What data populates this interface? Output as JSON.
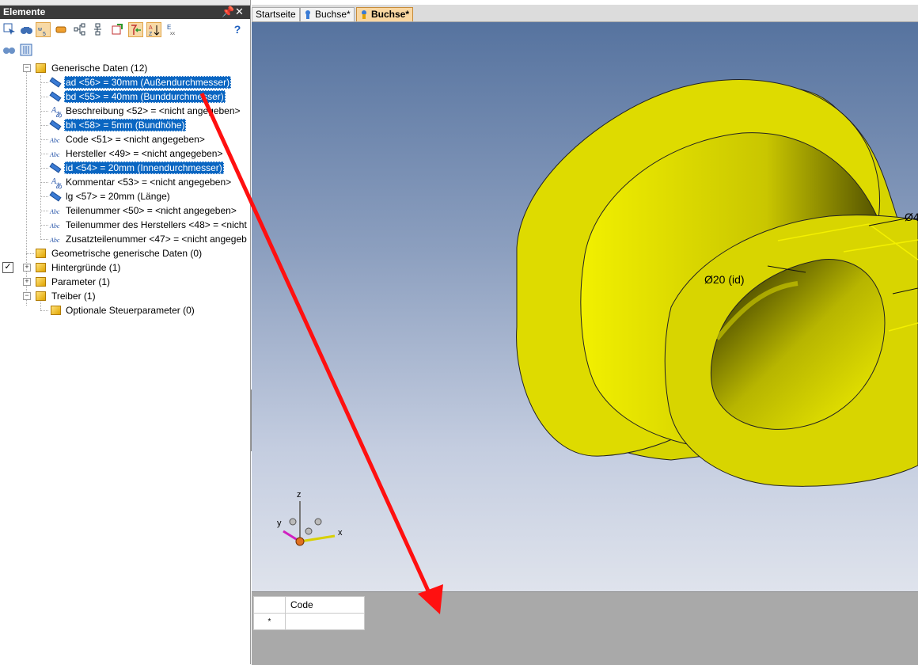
{
  "panel": {
    "title": "Elemente",
    "pin_glyph": "📌",
    "close_glyph": "✕",
    "help_glyph": "?"
  },
  "tree": {
    "root_label": "Generische Daten (12)",
    "items": [
      {
        "label": "ad <56> = 30mm (Außendurchmesser)",
        "icon": "ruler-icon",
        "selected": true
      },
      {
        "label": "bd <55> = 40mm (Bunddurchmesser)",
        "icon": "ruler-icon",
        "selected": true
      },
      {
        "label": "Beschreibung <52> = <nicht angegeben>",
        "icon": "text-icon",
        "selected": false
      },
      {
        "label": "bh <58> = 5mm (Bundhöhe)",
        "icon": "ruler-icon",
        "selected": true
      },
      {
        "label": "Code <51> = <nicht angegeben>",
        "icon": "abc-icon",
        "selected": false
      },
      {
        "label": "Hersteller <49> = <nicht angegeben>",
        "icon": "abc-icon",
        "selected": false
      },
      {
        "label": "id <54> = 20mm (Innendurchmesser)",
        "icon": "ruler-icon",
        "selected": true
      },
      {
        "label": "Kommentar <53> = <nicht angegeben>",
        "icon": "text-icon",
        "selected": false
      },
      {
        "label": "lg <57> = 20mm (Länge)",
        "icon": "ruler-icon",
        "selected": false
      },
      {
        "label": "Teilenummer <50> = <nicht angegeben>",
        "icon": "abc-icon",
        "selected": false
      },
      {
        "label": "Teilenummer des Herstellers <48> = <nicht",
        "icon": "abc-icon",
        "selected": false
      },
      {
        "label": "Zusatzteilenummer <47> = <nicht angegeb",
        "icon": "abc-icon",
        "selected": false
      }
    ],
    "groups": [
      {
        "label": "Geometrische generische Daten (0)"
      },
      {
        "label": "Hintergründe (1)"
      },
      {
        "label": "Parameter (1)"
      },
      {
        "label": "Treiber (1)"
      }
    ],
    "sub_item": "Optionale Steuerparameter (0)",
    "abc_text": "Abc"
  },
  "tabs": [
    {
      "label": "Startseite"
    },
    {
      "label": "Buchse*"
    },
    {
      "label": "Buchse*"
    }
  ],
  "viewport": {
    "dim_id": "Ø20 (id)",
    "dim_partial": "Ø4",
    "axis_x": "x",
    "axis_y": "y",
    "axis_z": "z",
    "part_color": "#e8e600"
  },
  "grid": {
    "header": "Code",
    "new_row_marker": "*"
  }
}
